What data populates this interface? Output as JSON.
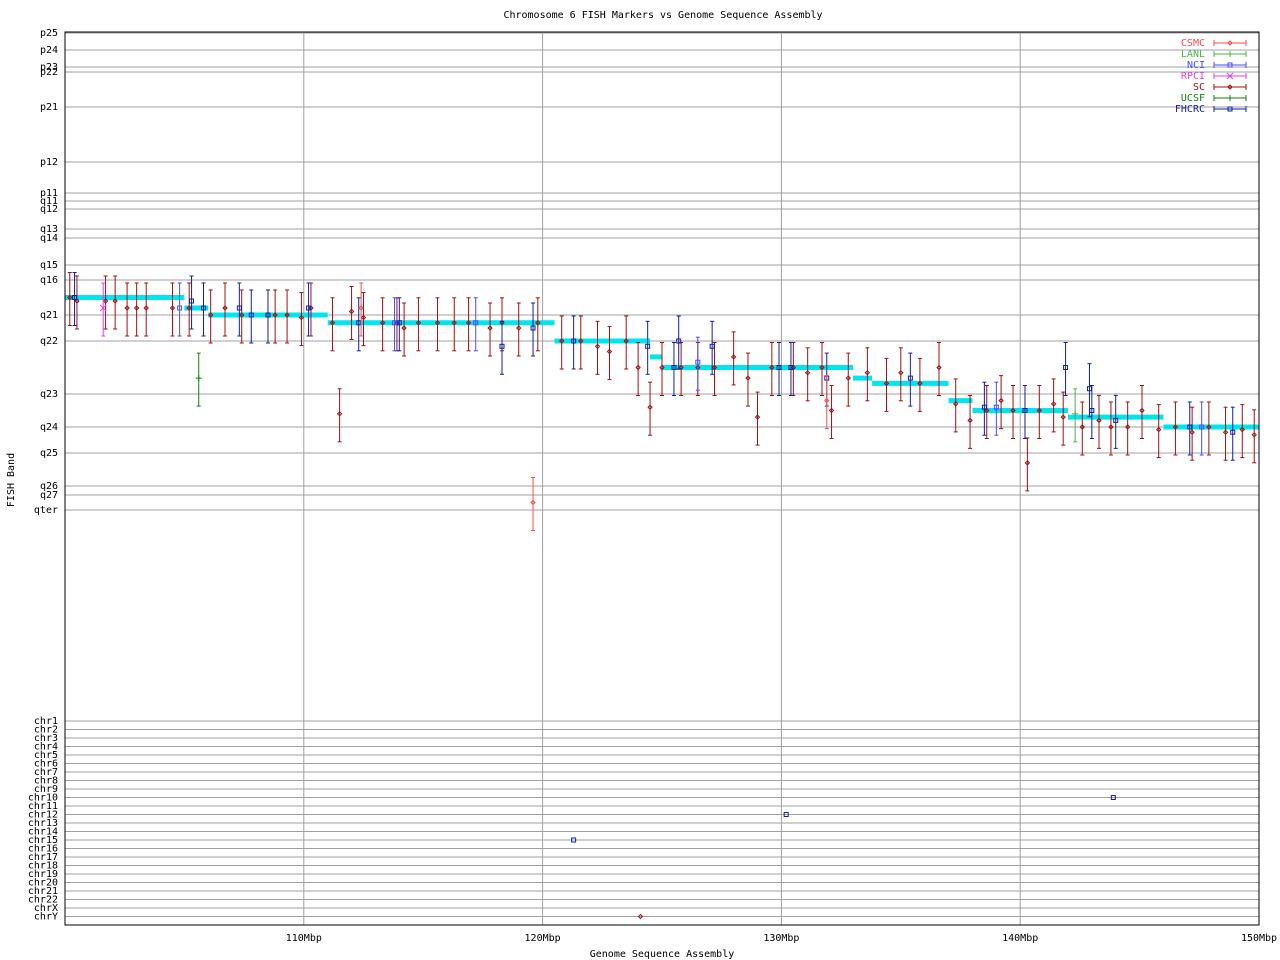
{
  "chart_data": {
    "type": "scatter",
    "title": "Chromosome 6 FISH Markers vs Genome Sequence Assembly",
    "xlabel": "Genome Sequence Assembly",
    "ylabel": "FISH Band",
    "xlim": [
      100,
      150
    ],
    "x_ticks": [
      {
        "value": 110,
        "label": "110Mbp"
      },
      {
        "value": 120,
        "label": "120Mbp"
      },
      {
        "value": 130,
        "label": "130Mbp"
      },
      {
        "value": 140,
        "label": "140Mbp"
      },
      {
        "value": 150,
        "label": "150Mbp"
      }
    ],
    "bands": [
      "p25",
      "p24",
      "p23",
      "p22",
      "p21",
      "p12",
      "p11",
      "q11",
      "q12",
      "q13",
      "q14",
      "q15",
      "q16",
      "q21",
      "q22",
      "q23",
      "q24",
      "q25",
      "q26",
      "q27",
      "qter"
    ],
    "chromosome_rows": [
      "chr1",
      "chr2",
      "chr3",
      "chr4",
      "chr5",
      "chr6",
      "chr7",
      "chr8",
      "chr9",
      "chr10",
      "chr11",
      "chr12",
      "chr13",
      "chr14",
      "chr15",
      "chr16",
      "chr17",
      "chr18",
      "chr19",
      "chr20",
      "chr21",
      "chr22",
      "chrX",
      "chrY"
    ],
    "grid": true,
    "legend_position": "top-right",
    "legend": [
      {
        "name": "CSMC",
        "color": "#ff4a4a",
        "marker": "diamond"
      },
      {
        "name": "LANL",
        "color": "#4ab34a",
        "marker": "plus"
      },
      {
        "name": "NCI",
        "color": "#4a4aff",
        "marker": "square"
      },
      {
        "name": "RPCI",
        "color": "#e040e0",
        "marker": "cross"
      },
      {
        "name": "SC",
        "color": "#a01010",
        "marker": "diamond"
      },
      {
        "name": "UCSF",
        "color": "#108010",
        "marker": "plus"
      },
      {
        "name": "FHCRC",
        "color": "#1020a0",
        "marker": "square"
      }
    ],
    "consensus": {
      "name": "band consensus",
      "color": "#00e5ee",
      "segments": [
        {
          "x": [
            100.0,
            105.0
          ],
          "band": "q16.5"
        },
        {
          "x": [
            105.0,
            106.0
          ],
          "band": "q16.8"
        },
        {
          "x": [
            106.0,
            111.0
          ],
          "band": "q21.0"
        },
        {
          "x": [
            111.0,
            120.5
          ],
          "band": "q21.3"
        },
        {
          "x": [
            120.5,
            124.5
          ],
          "band": "q22.0"
        },
        {
          "x": [
            124.5,
            125.0
          ],
          "band": "q22.3"
        },
        {
          "x": [
            125.0,
            133.0
          ],
          "band": "q22.5"
        },
        {
          "x": [
            133.0,
            133.8
          ],
          "band": "q22.7"
        },
        {
          "x": [
            133.8,
            137.0
          ],
          "band": "q22.8"
        },
        {
          "x": [
            137.0,
            138.0
          ],
          "band": "q23.2"
        },
        {
          "x": [
            138.0,
            142.0
          ],
          "band": "q23.5"
        },
        {
          "x": [
            142.0,
            146.0
          ],
          "band": "q23.7"
        },
        {
          "x": [
            146.0,
            150.0
          ],
          "band": "q24.0"
        }
      ]
    },
    "series": [
      {
        "name": "SC",
        "points": [
          {
            "x": 100.2,
            "band": "q16.5"
          },
          {
            "x": 100.5,
            "band": "q16.6"
          },
          {
            "x": 101.7,
            "band": "q16.6"
          },
          {
            "x": 102.1,
            "band": "q16.6"
          },
          {
            "x": 102.6,
            "band": "q16.8"
          },
          {
            "x": 103.0,
            "band": "q16.8"
          },
          {
            "x": 103.4,
            "band": "q16.8"
          },
          {
            "x": 104.5,
            "band": "q16.8"
          },
          {
            "x": 105.2,
            "band": "q16.8"
          },
          {
            "x": 106.1,
            "band": "q21.0"
          },
          {
            "x": 106.7,
            "band": "q16.8"
          },
          {
            "x": 107.4,
            "band": "q21.0"
          },
          {
            "x": 108.8,
            "band": "q21.0"
          },
          {
            "x": 109.3,
            "band": "q21.0"
          },
          {
            "x": 109.9,
            "band": "q21.1"
          },
          {
            "x": 110.3,
            "band": "q16.8"
          },
          {
            "x": 111.2,
            "band": "q21.3"
          },
          {
            "x": 111.5,
            "band": "q23.6"
          },
          {
            "x": 112.0,
            "band": "q16.9"
          },
          {
            "x": 112.5,
            "band": "q21.1"
          },
          {
            "x": 113.3,
            "band": "q21.3"
          },
          {
            "x": 113.9,
            "band": "q21.3"
          },
          {
            "x": 114.2,
            "band": "q21.5"
          },
          {
            "x": 114.8,
            "band": "q21.3"
          },
          {
            "x": 115.6,
            "band": "q21.3"
          },
          {
            "x": 116.3,
            "band": "q21.3"
          },
          {
            "x": 116.9,
            "band": "q21.3"
          },
          {
            "x": 117.8,
            "band": "q21.5"
          },
          {
            "x": 118.3,
            "band": "q21.3"
          },
          {
            "x": 119.0,
            "band": "q21.5"
          },
          {
            "x": 119.8,
            "band": "q21.3"
          },
          {
            "x": 120.8,
            "band": "q22.0"
          },
          {
            "x": 121.6,
            "band": "q22.0"
          },
          {
            "x": 122.3,
            "band": "q22.1"
          },
          {
            "x": 122.8,
            "band": "q22.2"
          },
          {
            "x": 123.5,
            "band": "q22.0"
          },
          {
            "x": 124.0,
            "band": "q22.5"
          },
          {
            "x": 124.1,
            "band": "chrY"
          },
          {
            "x": 124.5,
            "band": "q23.4"
          },
          {
            "x": 125.0,
            "band": "q22.5"
          },
          {
            "x": 125.8,
            "band": "q22.5"
          },
          {
            "x": 126.5,
            "band": "q22.5"
          },
          {
            "x": 127.2,
            "band": "q22.5"
          },
          {
            "x": 128.0,
            "band": "q22.3"
          },
          {
            "x": 128.6,
            "band": "q22.7"
          },
          {
            "x": 129.0,
            "band": "q23.7"
          },
          {
            "x": 129.6,
            "band": "q22.5"
          },
          {
            "x": 130.5,
            "band": "q22.5"
          },
          {
            "x": 131.1,
            "band": "q22.6"
          },
          {
            "x": 131.7,
            "band": "q22.5"
          },
          {
            "x": 132.1,
            "band": "q23.5"
          },
          {
            "x": 132.8,
            "band": "q22.7"
          },
          {
            "x": 133.6,
            "band": "q22.6"
          },
          {
            "x": 134.4,
            "band": "q22.8"
          },
          {
            "x": 135.0,
            "band": "q22.6"
          },
          {
            "x": 135.8,
            "band": "q22.8"
          },
          {
            "x": 136.6,
            "band": "q22.5"
          },
          {
            "x": 137.3,
            "band": "q23.3"
          },
          {
            "x": 137.9,
            "band": "q23.8"
          },
          {
            "x": 138.6,
            "band": "q23.5"
          },
          {
            "x": 139.2,
            "band": "q23.2"
          },
          {
            "x": 139.7,
            "band": "q23.5"
          },
          {
            "x": 140.3,
            "band": "q25.3"
          },
          {
            "x": 140.8,
            "band": "q23.5"
          },
          {
            "x": 141.4,
            "band": "q23.3"
          },
          {
            "x": 141.8,
            "band": "q23.7"
          },
          {
            "x": 142.6,
            "band": "q24.0"
          },
          {
            "x": 143.3,
            "band": "q23.8"
          },
          {
            "x": 143.8,
            "band": "q24.0"
          },
          {
            "x": 144.5,
            "band": "q24.0"
          },
          {
            "x": 145.1,
            "band": "q23.5"
          },
          {
            "x": 145.8,
            "band": "q24.1"
          },
          {
            "x": 146.5,
            "band": "q24.0"
          },
          {
            "x": 147.2,
            "band": "q24.2"
          },
          {
            "x": 147.9,
            "band": "q24.0"
          },
          {
            "x": 148.6,
            "band": "q24.2"
          },
          {
            "x": 149.3,
            "band": "q24.1"
          },
          {
            "x": 149.8,
            "band": "q24.3"
          }
        ]
      },
      {
        "name": "FHCRC",
        "points": [
          {
            "x": 100.4,
            "band": "q16.5"
          },
          {
            "x": 105.3,
            "band": "q16.6"
          },
          {
            "x": 105.8,
            "band": "q16.8"
          },
          {
            "x": 107.3,
            "band": "q16.8"
          },
          {
            "x": 107.8,
            "band": "q21.0"
          },
          {
            "x": 108.5,
            "band": "q21.0"
          },
          {
            "x": 110.2,
            "band": "q16.8"
          },
          {
            "x": 112.3,
            "band": "q21.3"
          },
          {
            "x": 114.0,
            "band": "q21.3"
          },
          {
            "x": 118.3,
            "band": "q22.1"
          },
          {
            "x": 119.6,
            "band": "q21.5"
          },
          {
            "x": 121.3,
            "band": "q22.0"
          },
          {
            "x": 121.3,
            "band": "chr15"
          },
          {
            "x": 124.4,
            "band": "q22.1"
          },
          {
            "x": 125.5,
            "band": "q22.5"
          },
          {
            "x": 125.7,
            "band": "q22.0"
          },
          {
            "x": 127.1,
            "band": "q22.1"
          },
          {
            "x": 129.9,
            "band": "q22.5"
          },
          {
            "x": 130.2,
            "band": "chr12"
          },
          {
            "x": 130.4,
            "band": "q22.5"
          },
          {
            "x": 131.9,
            "band": "q22.7"
          },
          {
            "x": 135.4,
            "band": "q22.7"
          },
          {
            "x": 138.5,
            "band": "q23.4"
          },
          {
            "x": 140.2,
            "band": "q23.5"
          },
          {
            "x": 141.9,
            "band": "q22.5"
          },
          {
            "x": 142.9,
            "band": "q22.9"
          },
          {
            "x": 143.0,
            "band": "q23.5"
          },
          {
            "x": 143.9,
            "band": "chr10"
          },
          {
            "x": 144.0,
            "band": "q23.8"
          },
          {
            "x": 147.1,
            "band": "q24.0"
          },
          {
            "x": 148.9,
            "band": "q24.2"
          }
        ]
      },
      {
        "name": "NCI",
        "points": [
          {
            "x": 104.8,
            "band": "q16.8"
          },
          {
            "x": 113.8,
            "band": "q21.3"
          },
          {
            "x": 117.2,
            "band": "q21.3"
          },
          {
            "x": 126.5,
            "band": "q22.4"
          },
          {
            "x": 139.0,
            "band": "q23.4"
          },
          {
            "x": 147.6,
            "band": "q24.0"
          }
        ]
      },
      {
        "name": "CSMC",
        "points": [
          {
            "x": 119.6,
            "band": "q27.5"
          },
          {
            "x": 112.4,
            "band": "q16.8"
          },
          {
            "x": 131.9,
            "band": "q23.2"
          }
        ]
      },
      {
        "name": "LANL",
        "points": [
          {
            "x": 142.3,
            "band": "q23.6"
          }
        ]
      },
      {
        "name": "RPCI",
        "points": [
          {
            "x": 101.6,
            "band": "q16.8"
          }
        ]
      },
      {
        "name": "UCSF",
        "points": [
          {
            "x": 105.6,
            "band": "q22.7"
          }
        ]
      }
    ]
  }
}
